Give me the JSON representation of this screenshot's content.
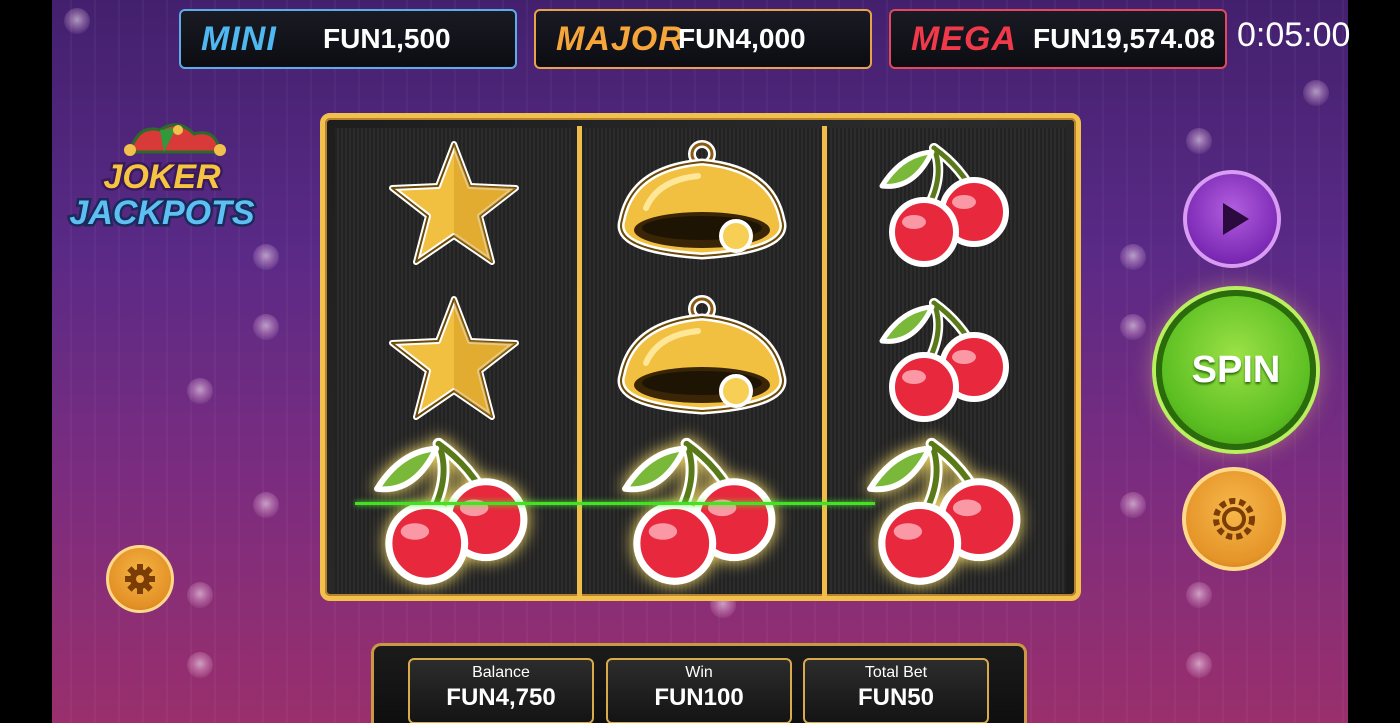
{
  "jackpots": {
    "mini": {
      "label": "MINI",
      "value": "FUN1,500"
    },
    "major": {
      "label": "MAJOR",
      "value": "FUN4,000"
    },
    "mega": {
      "label": "MEGA",
      "value": "FUN19,574.08"
    }
  },
  "timer": "0:05:00",
  "logo": {
    "line1": "JOKER",
    "line2": "JACKPOTS"
  },
  "reels": [
    [
      "star",
      "star",
      "cherry"
    ],
    [
      "bell",
      "bell",
      "cherry"
    ],
    [
      "cherry",
      "cherry",
      "cherry"
    ]
  ],
  "spin_label": "SPIN",
  "stats": {
    "balance": {
      "label": "Balance",
      "value": "FUN4,750"
    },
    "win": {
      "label": "Win",
      "value": "FUN100"
    },
    "total_bet": {
      "label": "Total Bet",
      "value": "FUN50"
    }
  },
  "icons": {
    "play": "play-icon",
    "bet": "chip-icon",
    "settings": "gear-icon"
  },
  "colors": {
    "mini": "#4fb8f0",
    "major": "#f6a53a",
    "mega": "#f03a4a",
    "spin": "#5cbf22",
    "play": "#7c2ab5",
    "gold": "#f2c04d",
    "payline": "#48e024"
  }
}
